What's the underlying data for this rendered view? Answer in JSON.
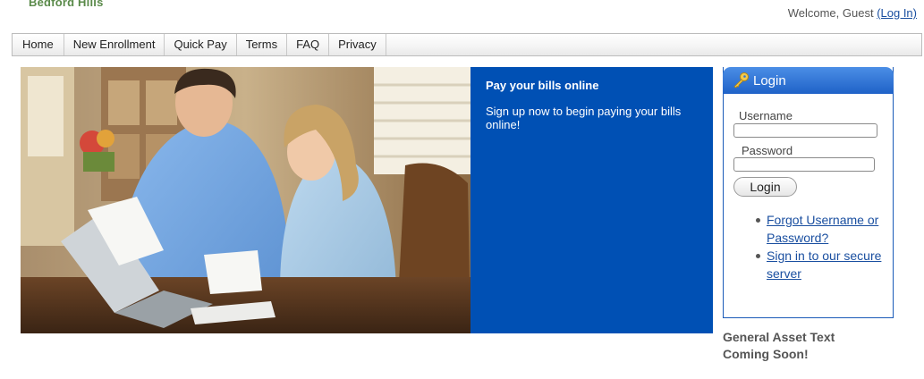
{
  "header": {
    "brand": "Bedford Hills",
    "welcome_text": "Welcome, Guest",
    "login_link": "(Log In)"
  },
  "nav": {
    "items": [
      {
        "label": "Home"
      },
      {
        "label": "New Enrollment"
      },
      {
        "label": "Quick Pay"
      },
      {
        "label": "Terms"
      },
      {
        "label": "FAQ"
      },
      {
        "label": "Privacy"
      }
    ]
  },
  "promo": {
    "title": "Pay your bills online",
    "body": "Sign up now to begin paying your bills online!"
  },
  "login": {
    "title": "Login",
    "username_label": "Username",
    "username_value": "",
    "password_label": "Password",
    "password_value": "",
    "button_label": "Login",
    "links": [
      {
        "label": "Forgot Username or Password?"
      },
      {
        "label": "Sign in to our secure server"
      }
    ]
  },
  "asset": {
    "text": "General Asset Text Coming Soon!"
  },
  "icons": {
    "login": "key-icon"
  },
  "colors": {
    "promo_bg": "#0050b4",
    "login_header": "#2e74d6",
    "link": "#1a4fa0",
    "brand": "#5a8a4a"
  }
}
